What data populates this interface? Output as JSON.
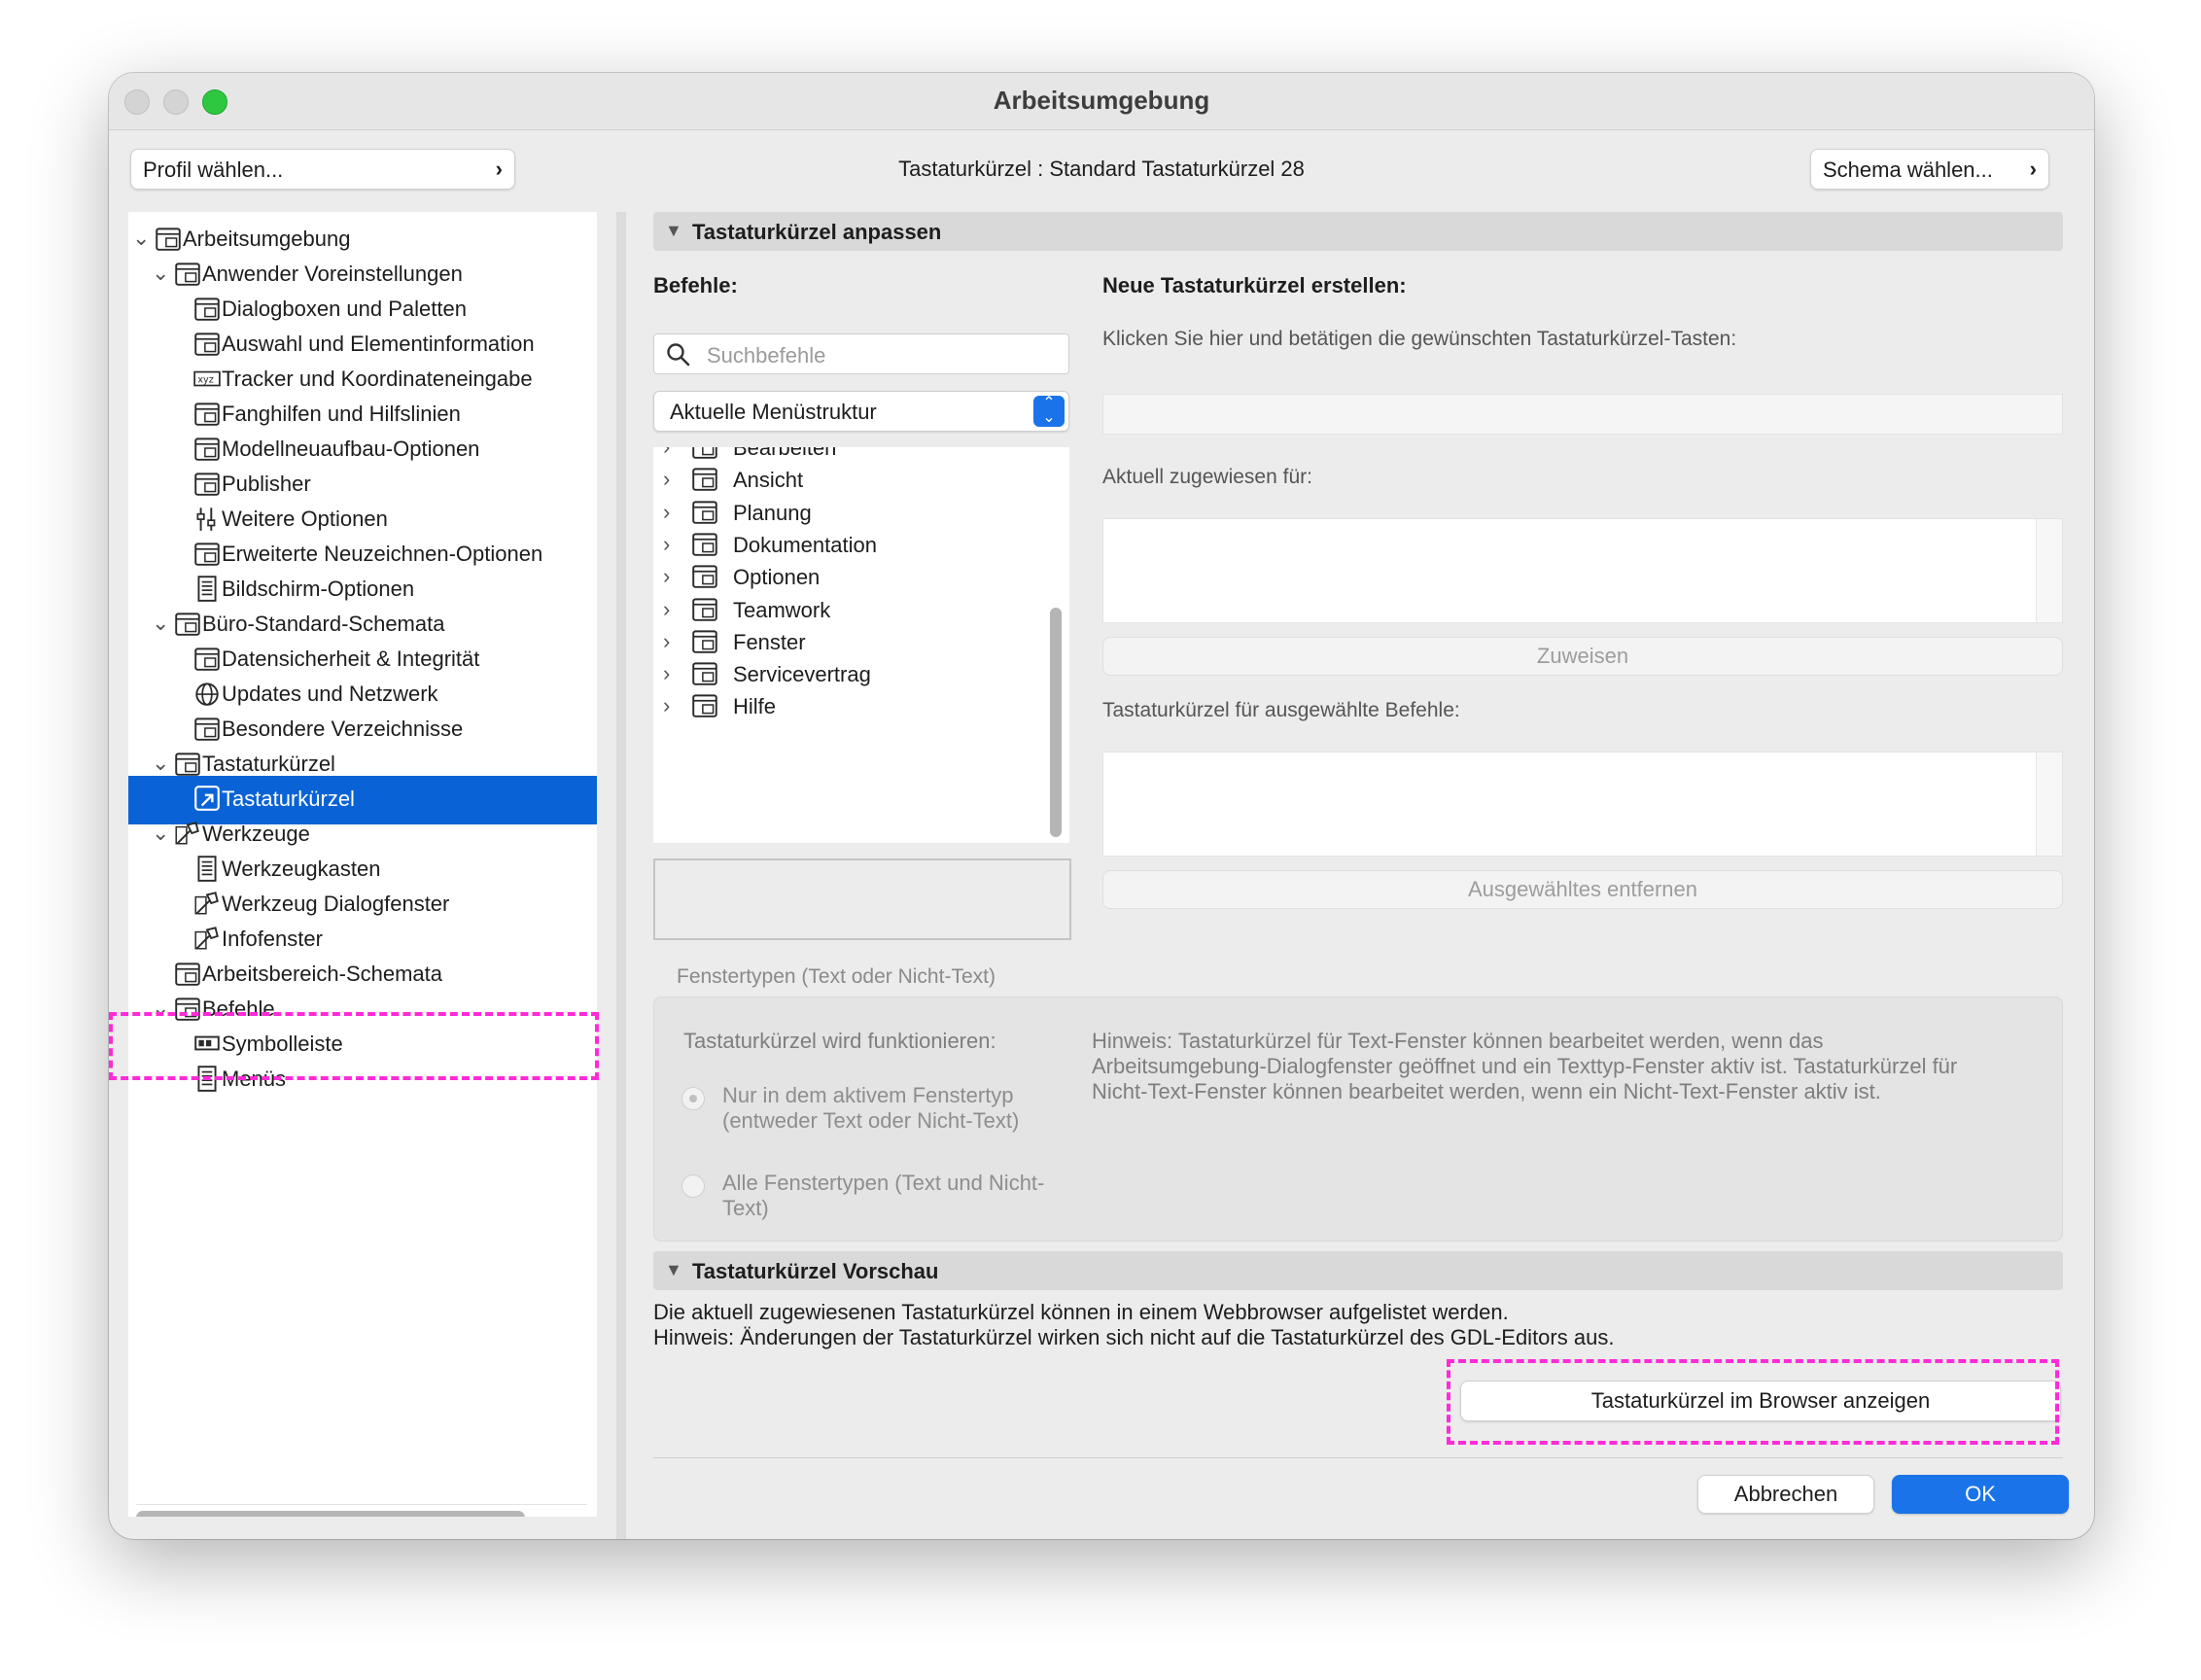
{
  "window": {
    "title": "Arbeitsumgebung"
  },
  "header": {
    "profile_button": "Profil wählen...",
    "shortcut_label": "Tastaturkürzel : ",
    "shortcut_value": "Standard Tastaturkürzel 28",
    "scheme_button": "Schema wählen..."
  },
  "tree": [
    {
      "label": "Arbeitsumgebung",
      "level": 0,
      "expanded": true
    },
    {
      "label": "Anwender Voreinstellungen",
      "level": 1,
      "expanded": true
    },
    {
      "label": "Dialogboxen und Paletten",
      "level": 2
    },
    {
      "label": "Auswahl und Elementinformation",
      "level": 2
    },
    {
      "label": "Tracker und Koordinateneingabe",
      "level": 2
    },
    {
      "label": "Fanghilfen und Hilfslinien",
      "level": 2
    },
    {
      "label": "Modellneuaufbau-Optionen",
      "level": 2
    },
    {
      "label": "Publisher",
      "level": 2
    },
    {
      "label": "Weitere Optionen",
      "level": 2
    },
    {
      "label": "Erweiterte Neuzeichnen-Optionen",
      "level": 2
    },
    {
      "label": "Bildschirm-Optionen",
      "level": 2
    },
    {
      "label": "Büro-Standard-Schemata",
      "level": 1,
      "expanded": true
    },
    {
      "label": "Datensicherheit & Integrität",
      "level": 2
    },
    {
      "label": "Updates und Netzwerk",
      "level": 2
    },
    {
      "label": "Besondere Verzeichnisse",
      "level": 2
    },
    {
      "label": "Tastaturkürzel",
      "level": 1,
      "expanded": true
    },
    {
      "label": "Tastaturkürzel",
      "level": 2,
      "selected": true
    },
    {
      "label": "Werkzeuge",
      "level": 1,
      "expanded": true
    },
    {
      "label": "Werkzeugkasten",
      "level": 2
    },
    {
      "label": "Werkzeug Dialogfenster",
      "level": 2
    },
    {
      "label": "Infofenster",
      "level": 2
    },
    {
      "label": "Arbeitsbereich-Schemata",
      "level": 1
    },
    {
      "label": "Befehle",
      "level": 1,
      "expanded": true
    },
    {
      "label": "Symbolleiste",
      "level": 2
    },
    {
      "label": "Menüs",
      "level": 2
    }
  ],
  "customize": {
    "section_title": "Tastaturkürzel anpassen",
    "commands_label": "Befehle:",
    "search_placeholder": "Suchbefehle",
    "structure_select": "Aktuelle Menüstruktur",
    "commands": [
      "Bearbeiten",
      "Ansicht",
      "Planung",
      "Dokumentation",
      "Optionen",
      "Teamwork",
      "Fenster",
      "Servicevertrag",
      "Hilfe"
    ],
    "new_shortcut_label": "Neue Tastaturkürzel erstellen:",
    "click_hint": "Klicken Sie hier und betätigen die gewünschten Tastaturkürzel-Tasten:",
    "assigned_label": "Aktuell zugewiesen für:",
    "assign_button": "Zuweisen",
    "selected_shortcuts_label": "Tastaturkürzel für ausgewählte Befehle:",
    "remove_button": "Ausgewähltes entfernen"
  },
  "window_types": {
    "group_label": "Fenstertypen (Text oder Nicht-Text)",
    "works_label": "Tastaturkürzel wird funktionieren:",
    "option1_line1": "Nur in dem aktivem Fenstertyp",
    "option1_line2": "(entweder Text oder Nicht-Text)",
    "option2_line1": "Alle Fenstertypen (Text und Nicht-",
    "option2_line2": "Text)",
    "hint_line1": "Hinweis: Tastaturkürzel für Text-Fenster können bearbeitet werden, wenn das",
    "hint_line2": "Arbeitsumgebung-Dialogfenster geöffnet und ein Texttyp-Fenster aktiv ist. Tastaturkürzel für",
    "hint_line3": "Nicht-Text-Fenster können bearbeitet werden, wenn ein Nicht-Text-Fenster aktiv ist."
  },
  "preview": {
    "section_title": "Tastaturkürzel Vorschau",
    "line1": "Die aktuell zugewiesenen Tastaturkürzel können in einem  Webbrowser aufgelistet werden.",
    "line2": "Hinweis: Änderungen der Tastaturkürzel wirken sich nicht auf die Tastaturkürzel des GDL-Editors aus.",
    "browser_button": "Tastaturkürzel im Browser anzeigen"
  },
  "footer": {
    "cancel": "Abbrechen",
    "ok": "OK"
  },
  "colors": {
    "selection": "#0a63d6",
    "accent": "#1a73e8",
    "highlight": "#ff2ad8"
  }
}
